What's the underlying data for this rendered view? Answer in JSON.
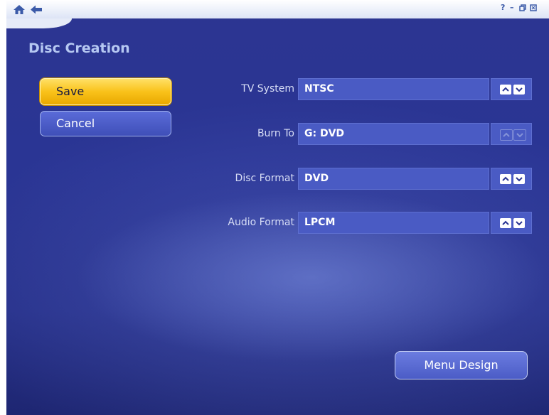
{
  "window": {
    "controls": [
      "?",
      "_",
      "restore",
      "close"
    ]
  },
  "page": {
    "title": "Disc Creation"
  },
  "actions": {
    "save_label": "Save",
    "cancel_label": "Cancel",
    "menu_design_label": "Menu Design"
  },
  "settings": [
    {
      "label": "TV System",
      "value": "NTSC",
      "enabled": true
    },
    {
      "label": "Burn To",
      "value": "G: DVD",
      "enabled": false
    },
    {
      "label": "Disc Format",
      "value": "DVD",
      "enabled": true
    },
    {
      "label": "Audio Format",
      "value": "LPCM",
      "enabled": true
    }
  ],
  "colors": {
    "background": "#2a3594",
    "accent": "#f9c21a",
    "field": "#4a5bc4",
    "title": "#b6c8f2"
  },
  "icons": {
    "home": "home-icon",
    "back": "back-arrow-icon",
    "up": "chevron-up-icon",
    "down": "chevron-down-icon"
  }
}
